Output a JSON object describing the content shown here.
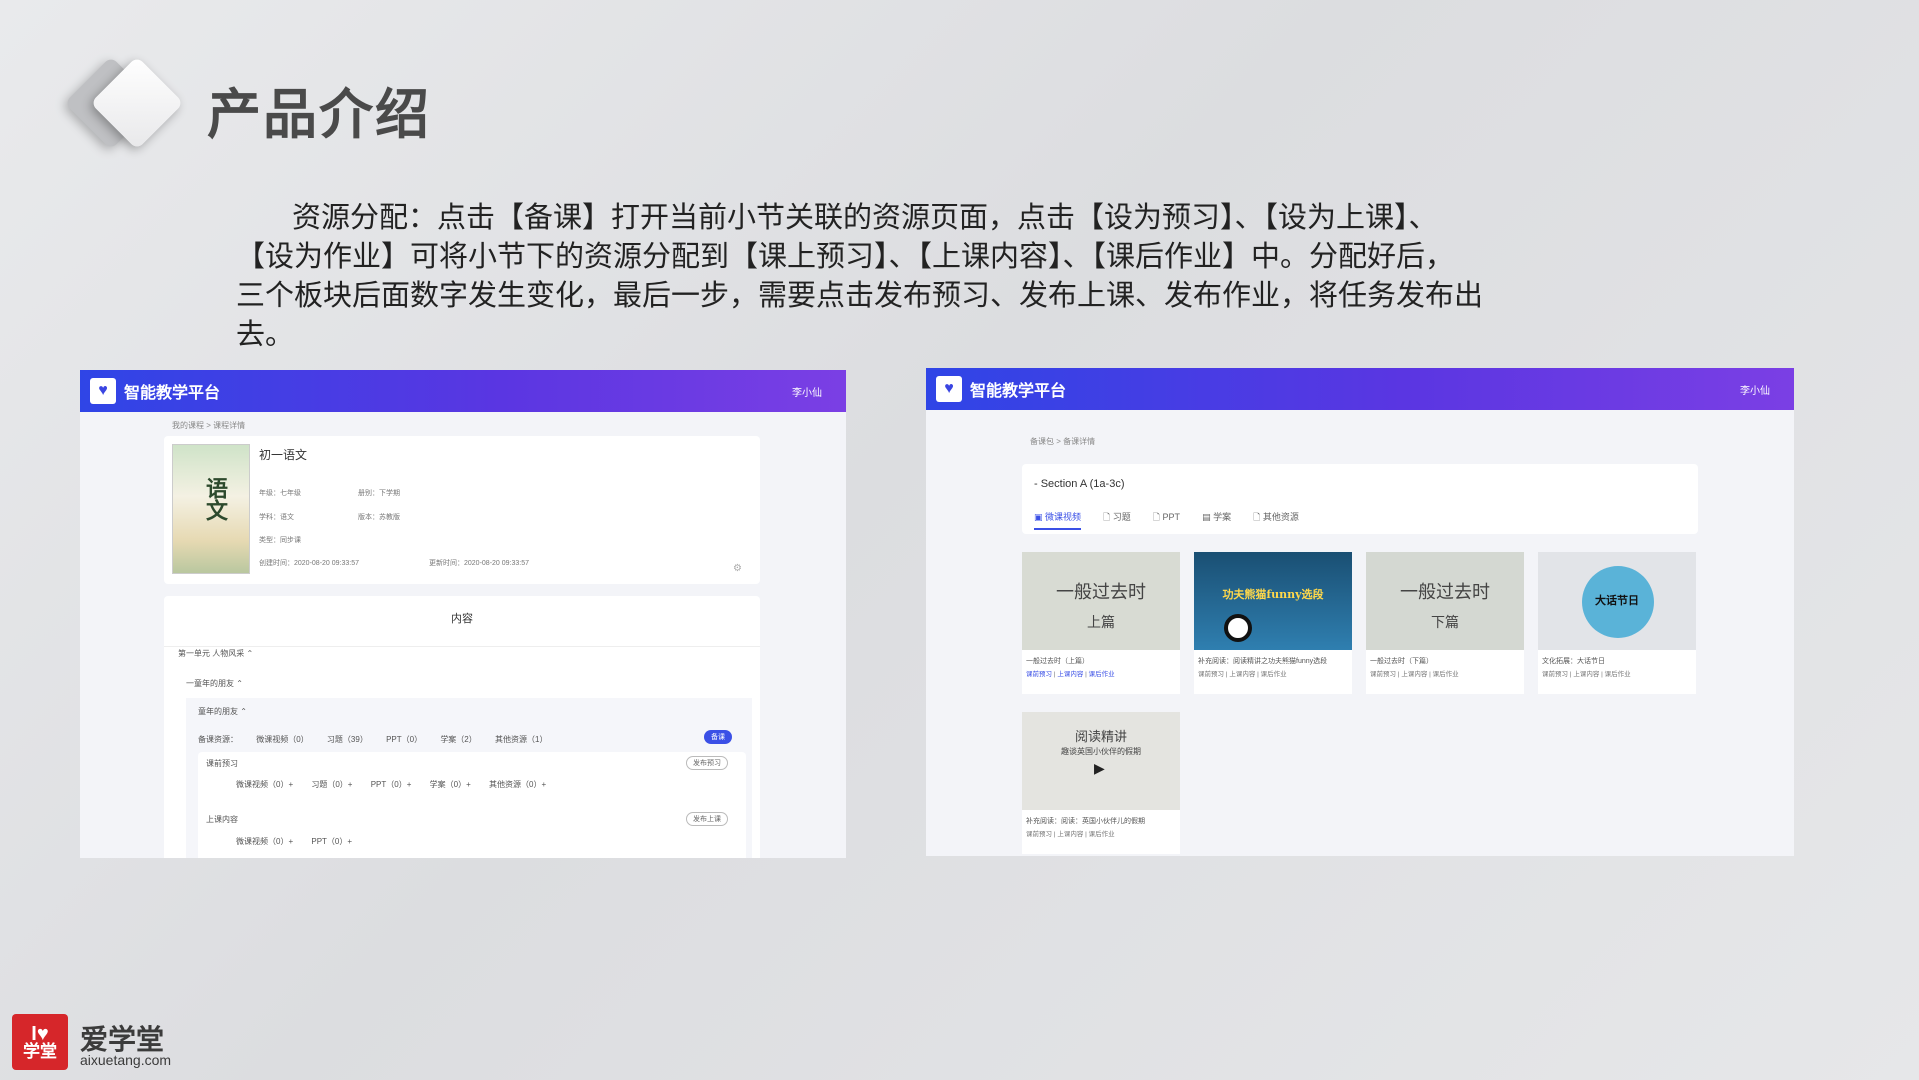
{
  "slide": {
    "title": "产品介绍",
    "description": [
      "资源分配：点击【备课】打开当前小节关联的资源页面，点击【设为预习】、【设为上课】、",
      "【设为作业】可将小节下的资源分配到【课上预习】、【上课内容】、【课后作业】中。分配好后，",
      "三个板块后面数字发生变化，最后一步，需要点击发布预习、发布上课、发布作业，将任务发布出",
      "去。"
    ]
  },
  "left_app": {
    "app_name": "智能教学平台",
    "user": "李小仙",
    "breadcrumb": "我的课程 > 课程详情",
    "course": {
      "title": "初一语文",
      "grade": "年级：七年级",
      "term": "册别：下学期",
      "subject": "学科：语文",
      "edition": "版本：苏教版",
      "type": "类型：同步课",
      "created": "创建时间：2020-08-20 09:33:57",
      "updated": "更新时间：2020-08-20 09:33:57",
      "cover_text": "语文"
    },
    "content": {
      "heading": "内容",
      "unit": "第一单元 人物风采 ⌃",
      "lesson": "一童年的朋友 ⌃",
      "section": "童年的朋友 ⌃",
      "prep_label": "备课资源：",
      "prep_items": [
        "微课视频（0）",
        "习题（39）",
        "PPT（0）",
        "学案（2）",
        "其他资源（1）"
      ],
      "prep_button": "备课",
      "preview_label": "课前预习",
      "preview_items": [
        "微课视频（0）+",
        "习题（0）+",
        "PPT（0）+",
        "学案（0）+",
        "其他资源（0）+"
      ],
      "preview_button": "发布预习",
      "class_label": "上课内容",
      "class_items": [
        "微课视频（0）+",
        "PPT（0）+"
      ],
      "class_button": "发布上课"
    }
  },
  "right_app": {
    "app_name": "智能教学平台",
    "user": "李小仙",
    "breadcrumb": "备课包 > 备课详情",
    "section_title": "- Section A (1a-3c)",
    "tabs": [
      "微课视频",
      "习题",
      "PPT",
      "学案",
      "其他资源"
    ],
    "tiles": [
      {
        "thumb_text": "一般过去时",
        "thumb_sub": "上篇",
        "title": "一般过去时（上篇）",
        "bg": "#d8dbd3"
      },
      {
        "thumb_text": "功夫熊猫funny选段",
        "thumb_sub": "",
        "title": "补充阅读：阅读精讲之功夫熊猫funny选段",
        "bg": "#1e5e86"
      },
      {
        "thumb_text": "一般过去时",
        "thumb_sub": "下篇",
        "title": "一般过去时（下篇）",
        "bg": "#d4d8d2"
      },
      {
        "thumb_text": "大话节日",
        "thumb_sub": "",
        "title": "文化拓展：大话节日",
        "bg": "#e2e4e8"
      },
      {
        "thumb_text": "阅读精讲",
        "thumb_sub": "趣谈英国小伙伴的假期",
        "title": "补充阅读：阅读：英国小伙伴儿的假期",
        "bg": "#e4e4e0"
      }
    ],
    "tile_actions": [
      "课前预习",
      "上课内容",
      "课后作业"
    ]
  },
  "footer": {
    "logo_line1": "I♥",
    "logo_line2": "学堂",
    "brand_name": "爱学堂",
    "brand_url": "aixuetang.com"
  }
}
